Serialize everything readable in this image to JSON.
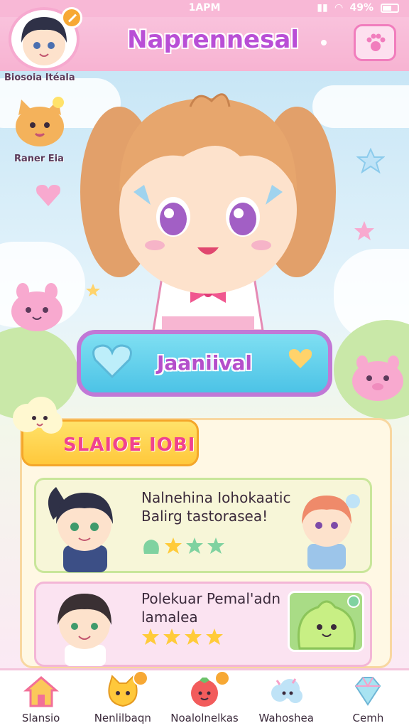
{
  "status_bar": {
    "time": "1APM",
    "battery": "49%"
  },
  "header": {
    "title": "Naprennesal"
  },
  "profile": {
    "player_name": "Biosoia Itéala",
    "pet_name": "Raner Eia"
  },
  "action": {
    "label": "Jaaniival"
  },
  "quests": {
    "banner": "SLAIOE IOBI",
    "items": [
      {
        "title": "Nalnehina Iohokaatic Balirg tastorasea!",
        "stars": 3
      },
      {
        "title": "Polekuar Pemal'adn lamalea",
        "stars": 4
      }
    ]
  },
  "bottom_nav": [
    {
      "label": "Slansio",
      "icon": "house-icon"
    },
    {
      "label": "Nenlilbaqn",
      "icon": "cat-face-icon"
    },
    {
      "label": "Noalolnelkas",
      "icon": "tomato-icon"
    },
    {
      "label": "Wahoshea",
      "icon": "cloud-pet-icon"
    },
    {
      "label": "Cemh",
      "icon": "gem-icon"
    }
  ],
  "colors": {
    "header": "#f7b3d2",
    "accent": "#b94fd6",
    "action_button": "#4cc3e6",
    "star": "#ffcb3a"
  }
}
